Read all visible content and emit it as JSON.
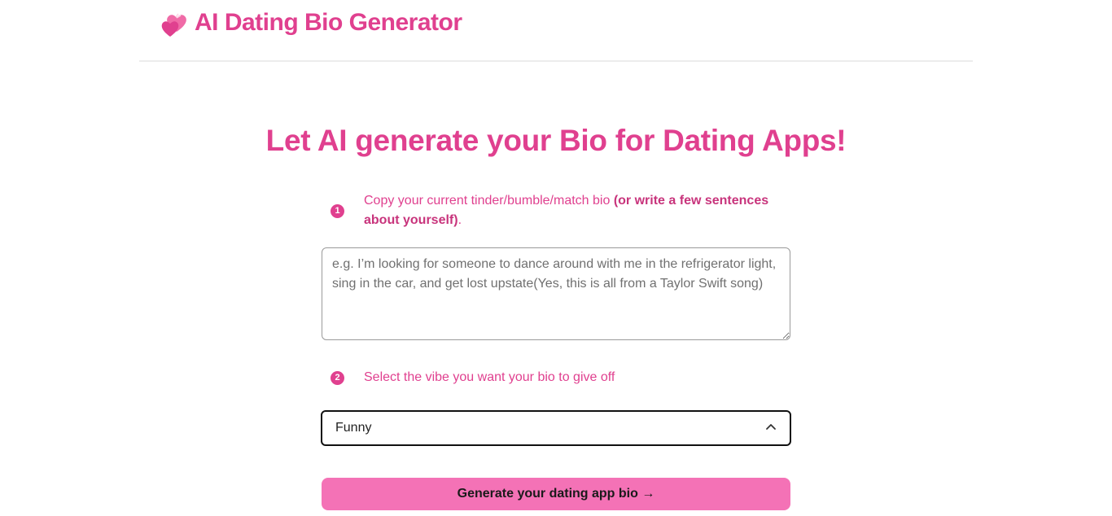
{
  "header": {
    "title": "AI Dating Bio Generator",
    "logo_icon": "two-hearts-icon"
  },
  "hero": {
    "title": "Let AI generate your Bio for Dating Apps!"
  },
  "steps": [
    {
      "number": "1",
      "text": "Copy your current tinder/bumble/match bio",
      "text_strong": "(or write a few sentences about yourself)",
      "text_suffix": "."
    },
    {
      "number": "2",
      "text": "Select the vibe you want your bio to give off"
    }
  ],
  "bio_input": {
    "value": "",
    "placeholder": "e.g. I’m looking for someone to dance around with me in the refrigerator light, sing in the car, and get lost upstate(Yes, this is all from a Taylor Swift song)"
  },
  "vibe_select": {
    "selected": "Funny",
    "icon": "chevron-up-icon"
  },
  "generate_button": {
    "label": "Generate your dating app bio →"
  },
  "colors": {
    "accent": "#e0408f",
    "button_bg": "#f472b6"
  }
}
